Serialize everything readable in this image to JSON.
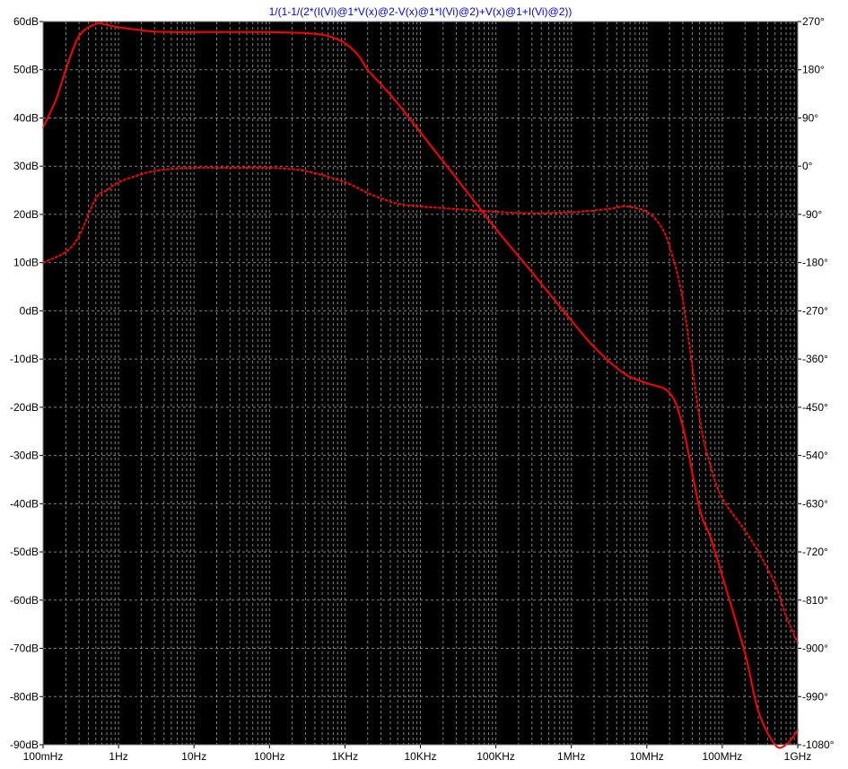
{
  "chart_data": {
    "type": "line",
    "title": "1/(1-1/(2*(I(Vi)@1*V(x)@2-V(x)@1*I(Vi)@2)+V(x)@1+I(Vi)@2))",
    "x_scale": "log",
    "x_unit": "Hz",
    "xlim": [
      0.1,
      1000000000
    ],
    "x_ticks": [
      0.1,
      1,
      10,
      100,
      1000,
      10000,
      100000,
      1000000,
      10000000,
      100000000,
      1000000000
    ],
    "x_tick_labels": [
      "100mHz",
      "1Hz",
      "10Hz",
      "100Hz",
      "1KHz",
      "10KHz",
      "100KHz",
      "1MHz",
      "10MHz",
      "100MHz",
      "1GHz"
    ],
    "y_left": {
      "unit": "dB",
      "ylim": [
        -90,
        60
      ],
      "ticks": [
        60,
        50,
        40,
        30,
        20,
        10,
        0,
        -10,
        -20,
        -30,
        -40,
        -50,
        -60,
        -70,
        -80,
        -90
      ],
      "tick_labels": [
        "60dB",
        "50dB",
        "40dB",
        "30dB",
        "20dB",
        "10dB",
        "0dB",
        "-10dB",
        "-20dB",
        "-30dB",
        "-40dB",
        "-50dB",
        "-60dB",
        "-70dB",
        "-80dB",
        "-90dB"
      ]
    },
    "y_right": {
      "unit": "degrees",
      "ylim": [
        -1080,
        270
      ],
      "ticks": [
        270,
        180,
        90,
        0,
        -90,
        -180,
        -270,
        -360,
        -450,
        -540,
        -630,
        -720,
        -810,
        -900,
        -990,
        -1080
      ],
      "tick_labels": [
        "270°",
        "180°",
        "90°",
        "0°",
        "-90°",
        "-180°",
        "-270°",
        "-360°",
        "-450°",
        "-540°",
        "-630°",
        "-720°",
        "-810°",
        "-900°",
        "-990°",
        "-1080°"
      ]
    },
    "grid": true,
    "colors": {
      "background": "#000000",
      "trace": "#ff0000",
      "grid": "#808080",
      "title": "#0000ff"
    },
    "series": [
      {
        "style": "solid",
        "axis": "left",
        "x": [
          0.1,
          0.15,
          0.2,
          0.3,
          0.5,
          0.7,
          1,
          2,
          3,
          5,
          10,
          30,
          100,
          300,
          600,
          1000,
          1500,
          2000,
          3000,
          5000,
          10000,
          30000,
          100000,
          300000,
          1000000,
          2000000,
          5000000,
          10000000,
          20000000,
          30000000,
          50000000,
          70000000,
          100000000,
          200000000,
          300000000,
          500000000,
          700000000,
          1000000000
        ],
        "values": [
          38,
          44,
          50,
          57,
          59.5,
          59.3,
          58.8,
          58.2,
          57.9,
          57.8,
          57.8,
          57.8,
          57.8,
          57.6,
          57,
          55.5,
          53,
          50,
          47,
          43,
          37,
          27.5,
          17,
          8,
          -2,
          -7.5,
          -13,
          -15,
          -17,
          -24,
          -41,
          -47,
          -55,
          -71,
          -83,
          -90,
          -90,
          -87
        ]
      },
      {
        "style": "dotted",
        "axis": "right",
        "x": [
          0.1,
          0.2,
          0.3,
          0.5,
          0.7,
          1,
          2,
          3,
          5,
          10,
          30,
          100,
          300,
          1000,
          2000,
          3000,
          5000,
          10000,
          30000,
          100000,
          300000,
          1000000,
          3000000,
          5000000,
          7000000,
          10000000,
          15000000,
          20000000,
          30000000,
          50000000,
          70000000,
          100000000,
          200000000,
          300000000,
          500000000,
          700000000,
          1000000000
        ],
        "values": [
          -180,
          -160,
          -130,
          -60,
          -45,
          -30,
          -15,
          -9,
          -5,
          -3,
          -3,
          -3,
          -9,
          -30,
          -50,
          -60,
          -70,
          -75,
          -80,
          -85,
          -88,
          -86,
          -80,
          -75,
          -78,
          -85,
          -110,
          -150,
          -250,
          -470,
          -560,
          -620,
          -680,
          -720,
          -780,
          -840,
          -890
        ]
      }
    ]
  }
}
